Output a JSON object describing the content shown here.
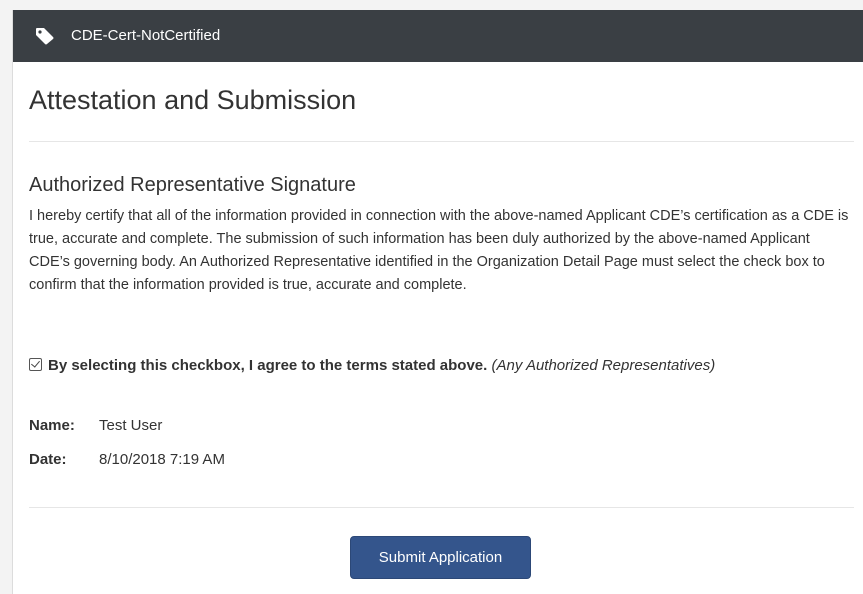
{
  "header": {
    "icon": "tag-icon",
    "title": "CDE-Cert-NotCertified",
    "background_color": "#3a3f44"
  },
  "page": {
    "title": "Attestation and Submission"
  },
  "signature_section": {
    "title": "Authorized Representative Signature",
    "certification_text": "I hereby certify that all of the information provided in connection with the above-named Applicant CDE’s certification as a CDE is true, accurate and complete. The submission of such information has been duly authorized by the above-named Applicant CDE’s governing body. An Authorized Representative identified in the Organization Detail Page must select the check box to confirm that the information provided is true, accurate and complete.",
    "agreement": {
      "checked": true,
      "label_bold": "By selecting this checkbox, I agree to the terms stated above.",
      "label_note": "(Any Authorized Representatives)"
    },
    "name_label": "Name:",
    "name_value": "Test User",
    "date_label": "Date:",
    "date_value": "8/10/2018 7:19 AM"
  },
  "actions": {
    "submit_label": "Submit Application",
    "submit_color": "#34558c"
  }
}
